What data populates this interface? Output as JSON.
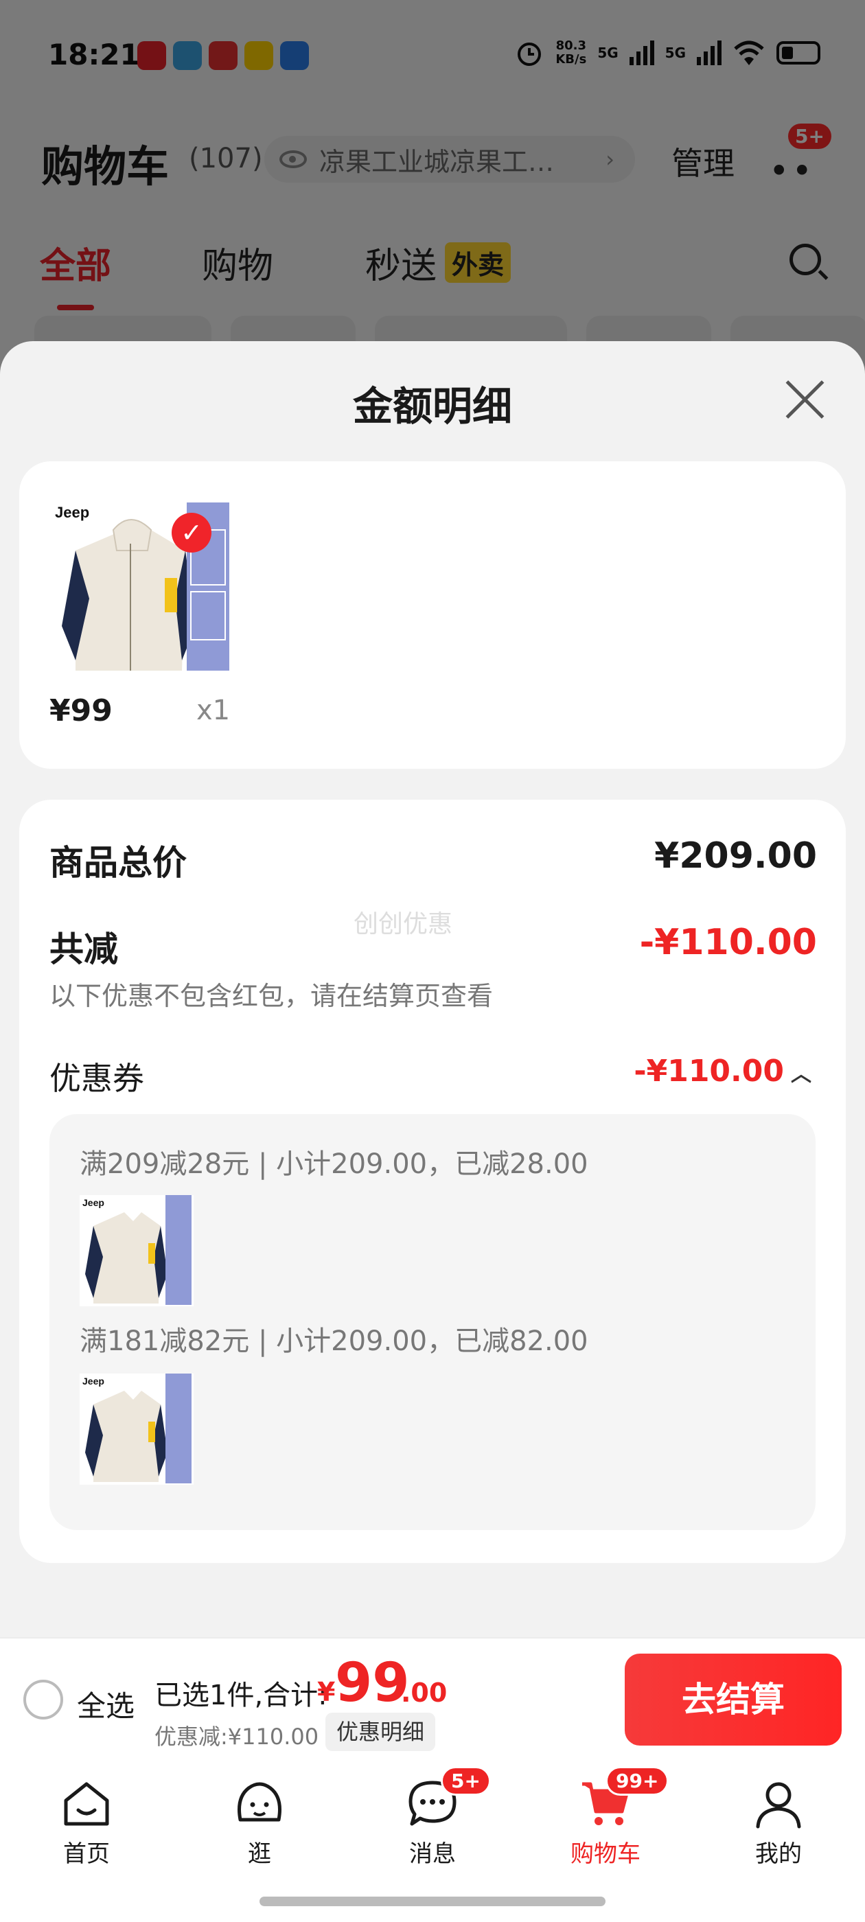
{
  "status_bar": {
    "time": "18:21",
    "net_speed_value": "80.3",
    "net_speed_unit": "KB/s",
    "sim1": "5G",
    "sim2": "5G"
  },
  "header": {
    "title": "购物车",
    "count": "(107)",
    "address": "凉果工业城凉果工…",
    "address_chevron": "›",
    "manage": "管理",
    "more_badge": "5+"
  },
  "tabs": [
    {
      "label": "全部"
    },
    {
      "label": "购物"
    },
    {
      "label": "秒送",
      "tag": "外卖"
    }
  ],
  "sheet": {
    "title": "金额明细",
    "item": {
      "price": "¥99",
      "qty": "x1"
    },
    "summary": {
      "total_label": "商品总价",
      "total_value": "¥209.00",
      "reduce_label": "共减",
      "reduce_value": "-¥110.00",
      "reduce_note": "以下优惠不包含红包，请在结算页查看",
      "watermark": "创创优惠",
      "coupon_label": "优惠券",
      "coupon_value": "-¥110.00",
      "coupon_chevron": "︿",
      "rules": [
        {
          "text": "满209减28元 | 小计209.00，已减28.00"
        },
        {
          "text": "满181减82元 | 小计209.00，已减82.00"
        }
      ]
    }
  },
  "checkout": {
    "select_all": "全选",
    "selected": "已选1件,合计:",
    "currency": "¥",
    "total_int": "99",
    "total_dec": ".00",
    "discount": "优惠减:¥110.00",
    "detail_button": "优惠明细",
    "checkout_button": "去结算"
  },
  "nav": [
    {
      "label": "首页",
      "icon": "home-icon"
    },
    {
      "label": "逛",
      "icon": "browse-icon"
    },
    {
      "label": "消息",
      "icon": "message-icon",
      "badge": "5+"
    },
    {
      "label": "购物车",
      "icon": "cart-icon",
      "badge": "99+",
      "active": true
    },
    {
      "label": "我的",
      "icon": "profile-icon"
    }
  ],
  "colors": {
    "accent": "#ee2424",
    "waimai_tag": "#ffd530",
    "background": "#f2f2f2"
  }
}
